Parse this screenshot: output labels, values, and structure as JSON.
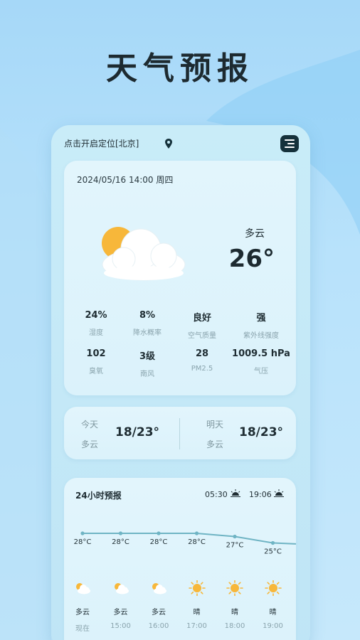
{
  "headline": "天气预报",
  "location": {
    "label": "点击开启定位[北京]"
  },
  "current": {
    "datetime": "2024/05/16 14:00 周四",
    "condition": "多云",
    "temperature": "26°",
    "weather_icon": "sun-behind-cloud-icon"
  },
  "stats": [
    {
      "value": "24%",
      "label": "湿度"
    },
    {
      "value": "8%",
      "label": "降水概率"
    },
    {
      "value": "良好",
      "label": "空气质量"
    },
    {
      "value": "强",
      "label": "紫外线强度"
    },
    {
      "value": "102",
      "label": "臭氧"
    },
    {
      "value": "3级",
      "label": "南风"
    },
    {
      "value": "28",
      "label": "PM2.5"
    },
    {
      "value": "1009.5 hPa",
      "label": "气压"
    }
  ],
  "range": {
    "today": {
      "day": "今天",
      "condition": "多云",
      "temps": "18/23°"
    },
    "tomorrow": {
      "day": "明天",
      "condition": "多云",
      "temps": "18/23°"
    }
  },
  "hourly": {
    "title": "24小时预报",
    "sunrise": "05:30",
    "sunset": "19:06",
    "items": [
      {
        "temp": "28°C",
        "temp_value": 28,
        "condition": "多云",
        "time": "现在",
        "icon": "cloudy-icon"
      },
      {
        "temp": "28°C",
        "temp_value": 28,
        "condition": "多云",
        "time": "15:00",
        "icon": "cloudy-icon"
      },
      {
        "temp": "28°C",
        "temp_value": 28,
        "condition": "多云",
        "time": "16:00",
        "icon": "cloudy-icon"
      },
      {
        "temp": "28°C",
        "temp_value": 28,
        "condition": "晴",
        "time": "17:00",
        "icon": "sunny-icon"
      },
      {
        "temp": "27°C",
        "temp_value": 27,
        "condition": "晴",
        "time": "18:00",
        "icon": "sunny-icon"
      },
      {
        "temp": "25°C",
        "temp_value": 25,
        "condition": "晴",
        "time": "19:00",
        "icon": "sunny-icon"
      }
    ]
  },
  "colors": {
    "accent_line": "#6fb4c4",
    "sun": "#f7b73a",
    "menu_bg": "#15313b"
  }
}
